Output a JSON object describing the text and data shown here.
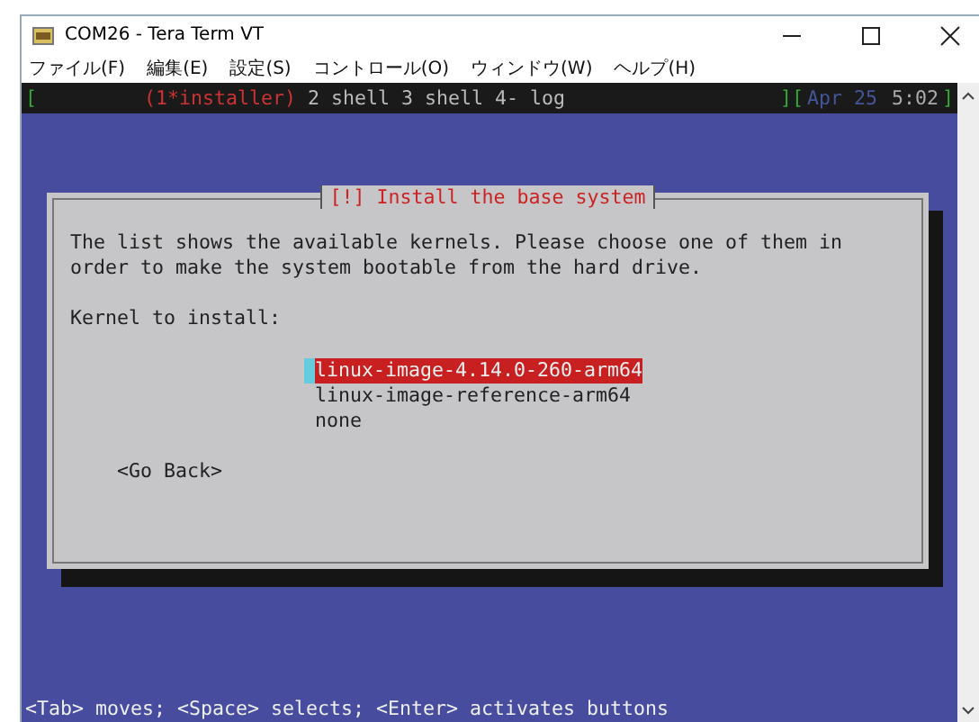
{
  "window": {
    "title": "COM26 - Tera Term VT"
  },
  "menu": [
    {
      "label": "ファイル(F)"
    },
    {
      "label": "編集(E)"
    },
    {
      "label": "設定(S)"
    },
    {
      "label": "コントロール(O)"
    },
    {
      "label": "ウィンドウ(W)"
    },
    {
      "label": "ヘルプ(H)"
    }
  ],
  "status_bar": {
    "open_bracket": "[",
    "windows": [
      {
        "label": "(1*installer)",
        "selected": true
      },
      {
        "label": "2 shell",
        "selected": false
      },
      {
        "label": "3 shell",
        "selected": false
      },
      {
        "label": "4- log",
        "selected": false
      }
    ],
    "middle_bracket": "][",
    "date": "Apr 25",
    "time": "5:02",
    "close_bracket": "]"
  },
  "dialog": {
    "title": "[!] Install the base system",
    "message": "The list shows the available kernels. Please choose one of them in order to make the system bootable from the hard drive.",
    "prompt": "Kernel to install:",
    "options": [
      {
        "label": "linux-image-4.14.0-260-arm64",
        "selected": true
      },
      {
        "label": "linux-image-reference-arm64",
        "selected": false
      },
      {
        "label": "none",
        "selected": false
      }
    ],
    "back_button": "<Go Back>"
  },
  "hint": "<Tab> moves; <Space> selects; <Enter> activates buttons"
}
